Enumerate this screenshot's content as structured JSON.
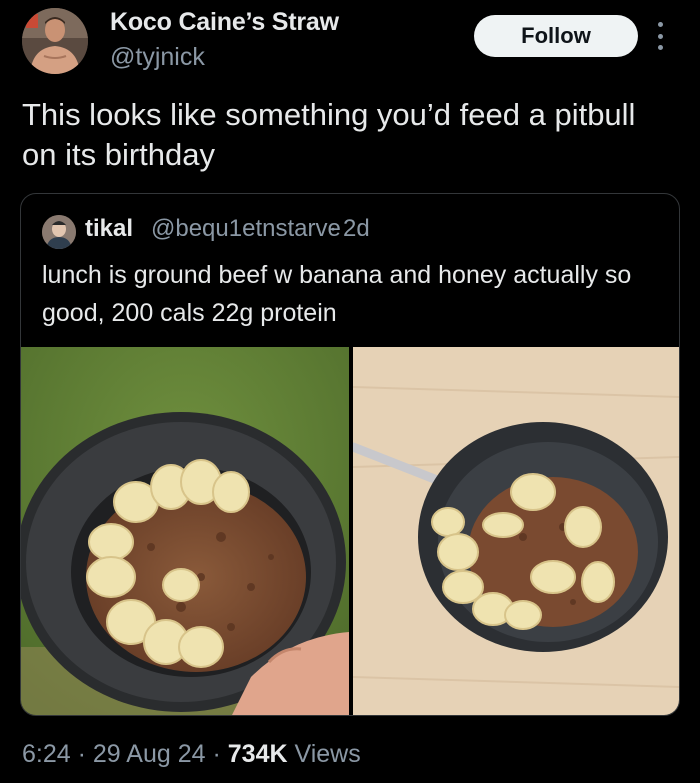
{
  "author": {
    "display_name": "Koco Caine’s Straw",
    "handle": "@tyjnick"
  },
  "follow_label": "Follow",
  "tweet": {
    "text": "This looks like something you’d feed a pitbull on its birthday"
  },
  "quote": {
    "name": "tikal",
    "handle": "@bequ1etnstarve",
    "separator": "·",
    "time": "2d",
    "text": "lunch is ground beef w banana and honey actually so good, 200 cals 22g protein"
  },
  "meta": {
    "time": "6:24",
    "date": "29 Aug 24",
    "views_count": "734K",
    "views_label": "Views",
    "separator": "·"
  },
  "colors": {
    "background": "#000000",
    "text": "#e7e9ea",
    "secondary": "#8b98a5",
    "follow_bg": "#eff3f4"
  },
  "icons": {
    "more": "more-dots-vertical-icon"
  }
}
